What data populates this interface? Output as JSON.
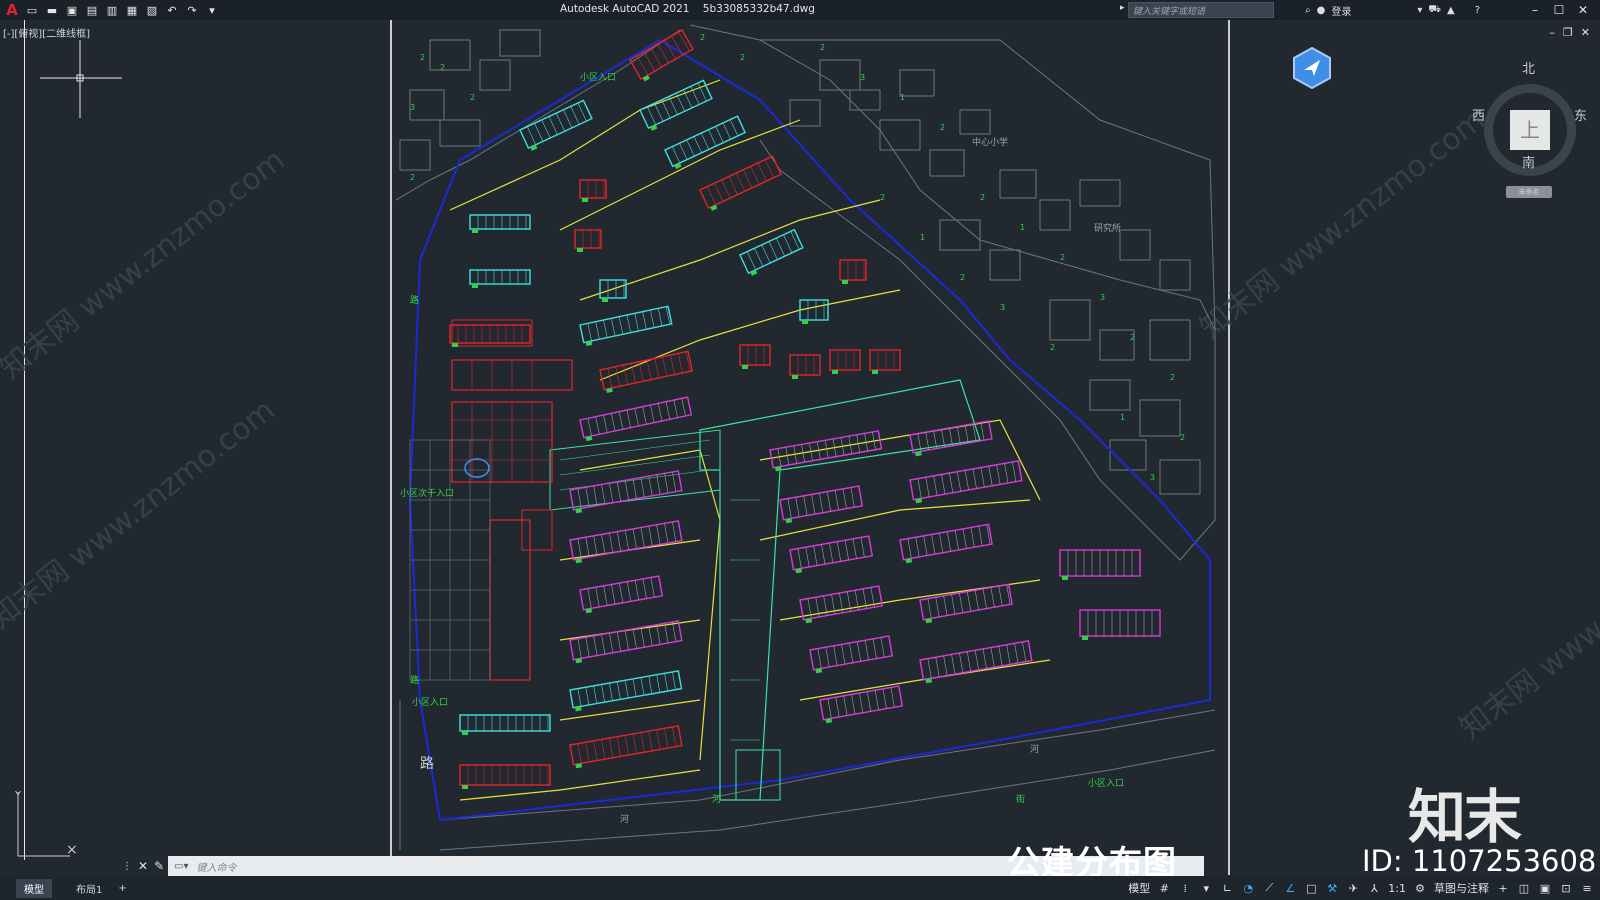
{
  "titlebar": {
    "app": "Autodesk AutoCAD 2021",
    "file": "5b33085332b47.dwg",
    "search_placeholder": "键入关键字或短语",
    "login": "登录"
  },
  "viewport": {
    "label": "[-][俯视][二维线框]"
  },
  "viewcube": {
    "north": "北",
    "south": "南",
    "west": "西",
    "east": "东",
    "face": "上",
    "wcs": "未命名"
  },
  "plan_labels": {
    "entry_top": "小区入口",
    "entry_left": "小区入口",
    "entry_west": "小区次干入口",
    "entry_bottom": "小区入口",
    "school": "中心小学",
    "institute": "研究所",
    "road_left": "路",
    "road_left2": "路",
    "road_left3": "路",
    "river_bottom": "河",
    "river_bottom2": "河",
    "river_right": "河",
    "street": "街"
  },
  "cmdline": {
    "placeholder": "键入命令"
  },
  "statusbar": {
    "tab_model": "模型",
    "tab_layout1": "布局1",
    "model_label": "模型",
    "scale": "1:1",
    "workspace": "草图与注释"
  },
  "watermark": {
    "site": "知末网 www.znzmo.com",
    "caption": "公建分布图",
    "brand": "知末",
    "id": "ID: 1107253608"
  },
  "colors": {
    "background": "#212830",
    "accent": "#3fa9f5",
    "red": "#e3242b",
    "green": "#35d04a",
    "magenta": "#d93ad9",
    "cyan": "#3fe0e0",
    "yellow": "#e8e23a",
    "blue": "#1a2bd6"
  }
}
